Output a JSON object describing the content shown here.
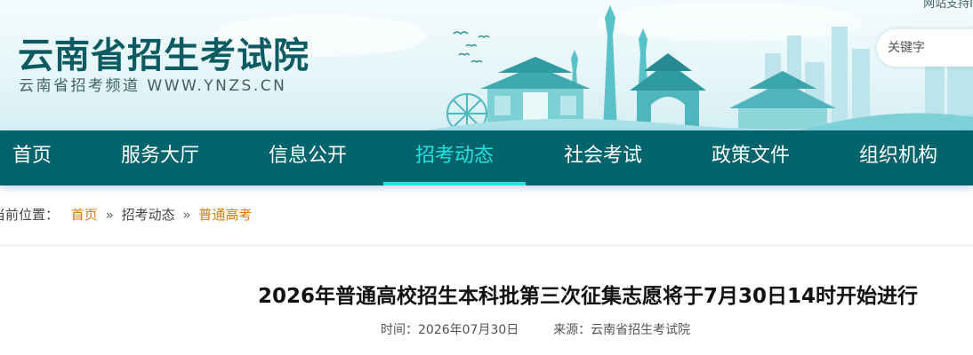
{
  "header": {
    "title": "云南省招生考试院",
    "subtitle": "云南省招考频道 WWW.YNZS.CN",
    "top_link": "网站支持I",
    "search": {
      "placeholder": "关键字"
    }
  },
  "nav": {
    "items": [
      {
        "label": "首页",
        "active": false
      },
      {
        "label": "服务大厅",
        "active": false
      },
      {
        "label": "信息公开",
        "active": false
      },
      {
        "label": "招考动态",
        "active": true
      },
      {
        "label": "社会考试",
        "active": false
      },
      {
        "label": "政策文件",
        "active": false
      },
      {
        "label": "组织机构",
        "active": false
      }
    ]
  },
  "breadcrumb": {
    "prefix": "当前位置：",
    "items": [
      "首页",
      "招考动态",
      "普通高考"
    ],
    "separator": "»"
  },
  "article": {
    "title": "2026年普通高校招生本科批第三次征集志愿将于7月30日14时开始进行",
    "time_label": "时间：",
    "time_value": "2026年07月30日",
    "source_label": "来源：",
    "source_value": "云南省招生考试院"
  },
  "colors": {
    "nav_bg": "#01636b",
    "nav_active": "#22e3e0",
    "breadcrumb_link": "#e07b00",
    "title_color": "#0c5b62"
  },
  "icons": [
    "birds-decoration",
    "ferris-wheel-decoration",
    "pagoda-decoration",
    "city-skyline-decoration"
  ]
}
